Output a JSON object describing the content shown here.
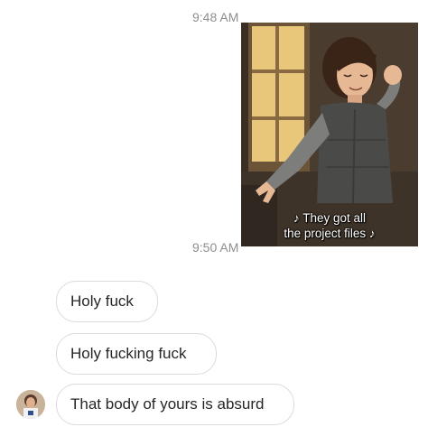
{
  "thread": {
    "timestamp_1": "9:48 AM",
    "timestamp_2": "9:50 AM",
    "media": {
      "caption_line1": "♪ They got all",
      "caption_line2": "the project files ♪"
    },
    "messages": [
      {
        "text": "Holy fuck"
      },
      {
        "text": "Holy fucking fuck"
      },
      {
        "text": "That body of yours is absurd"
      }
    ]
  },
  "colors": {
    "background": "#ffffff",
    "bubble_border": "#dbdbdb",
    "text": "#262626",
    "timestamp": "#8e8e8e"
  }
}
